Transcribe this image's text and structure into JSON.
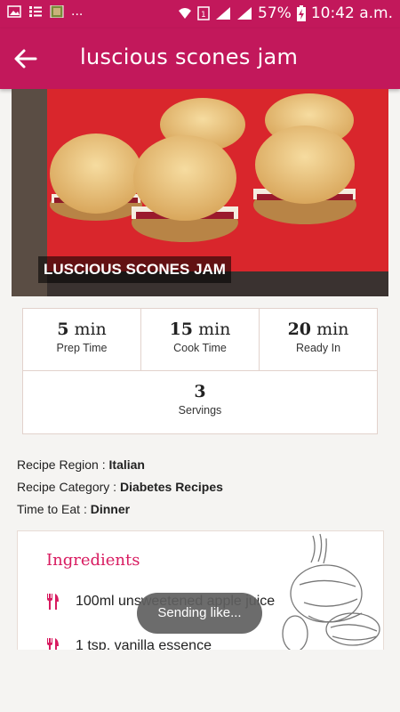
{
  "status_bar": {
    "battery": "57%",
    "time": "10:42 a.m.",
    "more": "..."
  },
  "appbar": {
    "title": "luscious scones jam"
  },
  "hero": {
    "caption": "LUSCIOUS SCONES JAM"
  },
  "stats": {
    "prep": {
      "value": "5",
      "unit": "min",
      "label": "Prep Time"
    },
    "cook": {
      "value": "15",
      "unit": "min",
      "label": "Cook Time"
    },
    "ready": {
      "value": "20",
      "unit": "min",
      "label": "Ready In"
    },
    "servings": {
      "value": "3",
      "label": "Servings"
    }
  },
  "meta": {
    "region_label": "Recipe Region :",
    "region_value": "Italian",
    "category_label": "Recipe Category :",
    "category_value": "Diabetes Recipes",
    "time_label": "Time to Eat :",
    "time_value": "Dinner"
  },
  "ingredients": {
    "title": "Ingredients",
    "items": [
      "100ml unsweetened apple juice",
      "1 tsp. vanilla essence"
    ]
  },
  "toast": "Sending like..."
}
